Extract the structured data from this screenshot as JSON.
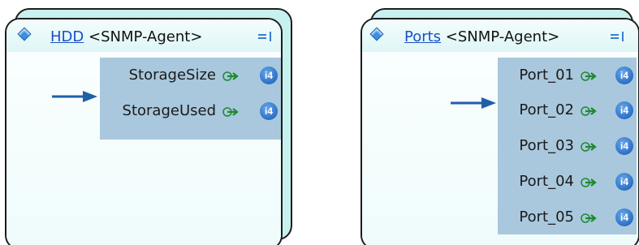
{
  "blocks": [
    {
      "name": "HDD",
      "type_label": "<SNMP-Agent>",
      "outputs": [
        {
          "label": "StorageSize",
          "type": "i4"
        },
        {
          "label": "StorageUsed",
          "type": "i4"
        }
      ]
    },
    {
      "name": "Ports",
      "type_label": "<SNMP-Agent>",
      "outputs": [
        {
          "label": "Port_01",
          "type": "i4"
        },
        {
          "label": "Port_02",
          "type": "i4"
        },
        {
          "label": "Port_03",
          "type": "i4"
        },
        {
          "label": "Port_04",
          "type": "i4"
        },
        {
          "label": "Port_05",
          "type": "i4"
        }
      ]
    }
  ],
  "colors": {
    "shadow_fill": "#c7f1ef",
    "output_area": "#a9c8dd",
    "link_name": "#1a4fc4",
    "arrow": "#1f5fa8",
    "type_badge": "#2b6fc6",
    "connector_green": "#1e8a2e"
  },
  "icons": [
    "diamond-icon",
    "menu-icon",
    "output-link-icon",
    "type-badge-icon",
    "input-arrow-icon"
  ]
}
